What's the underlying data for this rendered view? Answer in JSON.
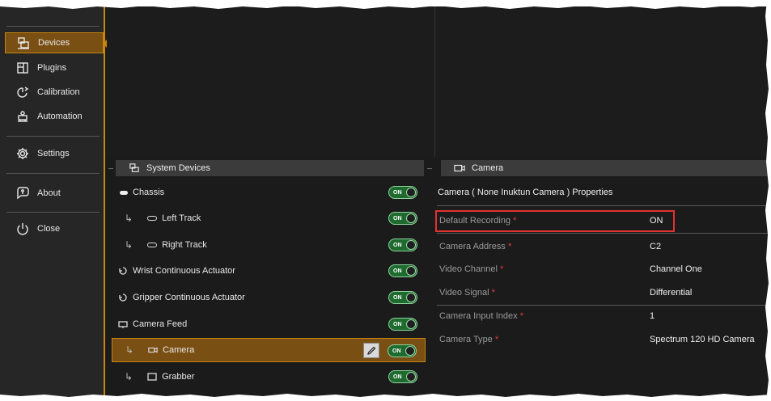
{
  "sidebar": {
    "items": [
      {
        "label": "Devices",
        "icon": "devices-icon",
        "active": true
      },
      {
        "label": "Plugins",
        "icon": "plugins-icon"
      },
      {
        "label": "Calibration",
        "icon": "calibration-icon"
      },
      {
        "label": "Automation",
        "icon": "automation-icon"
      },
      {
        "label": "Settings",
        "icon": "gear-icon"
      },
      {
        "label": "About",
        "icon": "about-icon"
      },
      {
        "label": "Close",
        "icon": "power-icon"
      }
    ]
  },
  "system_devices": {
    "title": "System Devices",
    "toggle_label": "ON",
    "rows": [
      {
        "label": "Chassis",
        "state": "ON"
      },
      {
        "label": "Left Track",
        "state": "ON"
      },
      {
        "label": "Right Track",
        "state": "ON"
      },
      {
        "label": "Wrist Continuous Actuator",
        "state": "ON"
      },
      {
        "label": "Gripper Continuous Actuator",
        "state": "ON"
      },
      {
        "label": "Camera Feed",
        "state": "ON"
      },
      {
        "label": "Camera",
        "state": "ON",
        "selected": true
      },
      {
        "label": "Grabber",
        "state": "ON"
      }
    ]
  },
  "camera_panel": {
    "title": "Camera",
    "properties_title": "Camera ( None Inuktun Camera ) Properties",
    "required_mark": "*",
    "properties": [
      {
        "name": "Default Recording",
        "value": "ON"
      },
      {
        "name": "Camera Address",
        "value": "C2"
      },
      {
        "name": "Video Channel",
        "value": "Channel One"
      },
      {
        "name": "Video Signal",
        "value": "Differential"
      },
      {
        "name": "Camera Input Index",
        "value": "1"
      },
      {
        "name": "Camera Type",
        "value": "Spectrum 120 HD Camera"
      }
    ]
  },
  "colors": {
    "accent": "#c8860d",
    "selected_bg": "#7a4f14",
    "toggle_on": "#1f6b2f",
    "highlight_box": "#e2332f",
    "required": "#e04040"
  }
}
